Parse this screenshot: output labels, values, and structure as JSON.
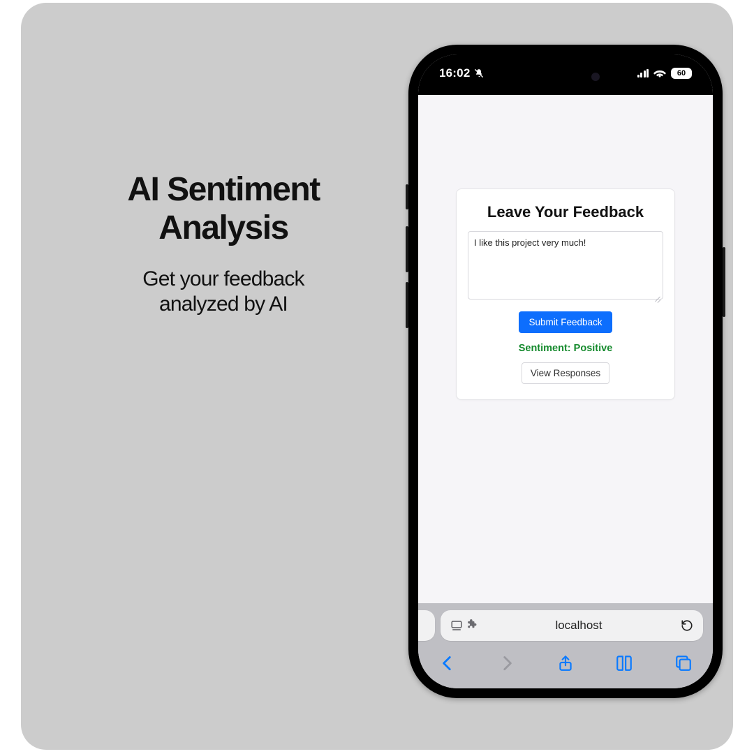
{
  "headline": {
    "title_line1": "AI Sentiment",
    "title_line2": "Analysis",
    "subtitle_line1": "Get your feedback",
    "subtitle_line2": "analyzed by AI"
  },
  "statusbar": {
    "time": "16:02",
    "battery": "60"
  },
  "card": {
    "heading": "Leave Your Feedback",
    "textarea_value": "I like this project very much!",
    "submit_label": "Submit Feedback",
    "sentiment_text": "Sentiment: Positive",
    "view_responses_label": "View Responses"
  },
  "urlbar": {
    "host": "localhost"
  }
}
